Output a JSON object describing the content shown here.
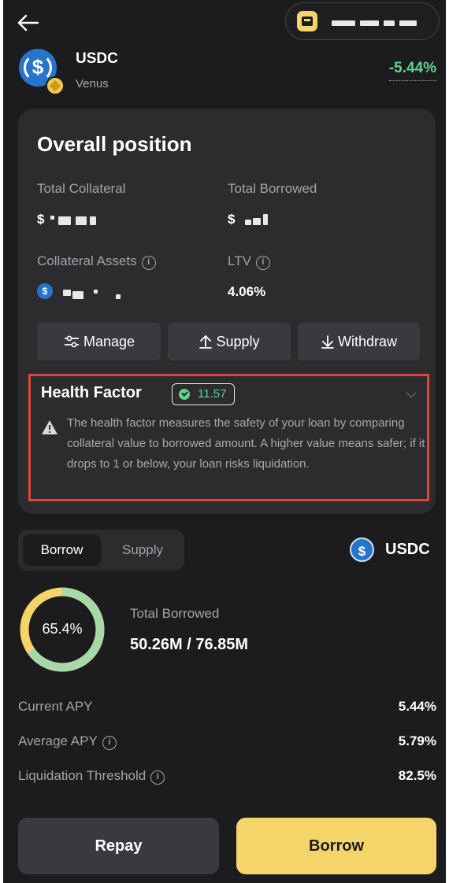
{
  "header": {
    "back_icon": "arrow-left-icon",
    "wallet_icon": "wallet-icon",
    "wallet_address_masked": true
  },
  "asset": {
    "symbol": "USDC",
    "protocol": "Venus",
    "change": "-5.44%",
    "change_color": "#5fd38d",
    "logo_icon": "usdc-icon",
    "protocol_icon": "venus-icon"
  },
  "position": {
    "title": "Overall position",
    "total_collateral_label": "Total Collateral",
    "total_collateral_prefix": "$",
    "total_borrowed_label": "Total Borrowed",
    "total_borrowed_prefix": "$",
    "collateral_assets_label": "Collateral Assets",
    "ltv_label": "LTV",
    "ltv_value": "4.06%",
    "actions": {
      "manage": "Manage",
      "supply": "Supply",
      "withdraw": "Withdraw"
    }
  },
  "health": {
    "title": "Health Factor",
    "value": "11.57",
    "description": "The health factor measures the safety of your loan by comparing collateral value to borrowed amount. A higher value means safer; if it drops to 1 or below, your loan risks liquidation."
  },
  "market": {
    "tabs": [
      "Borrow",
      "Supply"
    ],
    "active_tab": "Borrow",
    "token": "USDC",
    "utilization": "65.4%",
    "utilization_fraction": 0.654,
    "total_borrowed_label": "Total Borrowed",
    "total_borrowed_value": "50.26M / 76.85M",
    "rows": [
      {
        "label": "Current APY",
        "value": "5.44%",
        "info": false
      },
      {
        "label": "Average APY",
        "value": "5.79%",
        "info": true
      },
      {
        "label": "Liquidation Threshold",
        "value": "82.5%",
        "info": true
      }
    ]
  },
  "footer": {
    "repay": "Repay",
    "borrow": "Borrow"
  },
  "colors": {
    "accent_yellow": "#f5d46a",
    "donut_green": "#a8d8a8",
    "alert_red": "#e0443a"
  }
}
